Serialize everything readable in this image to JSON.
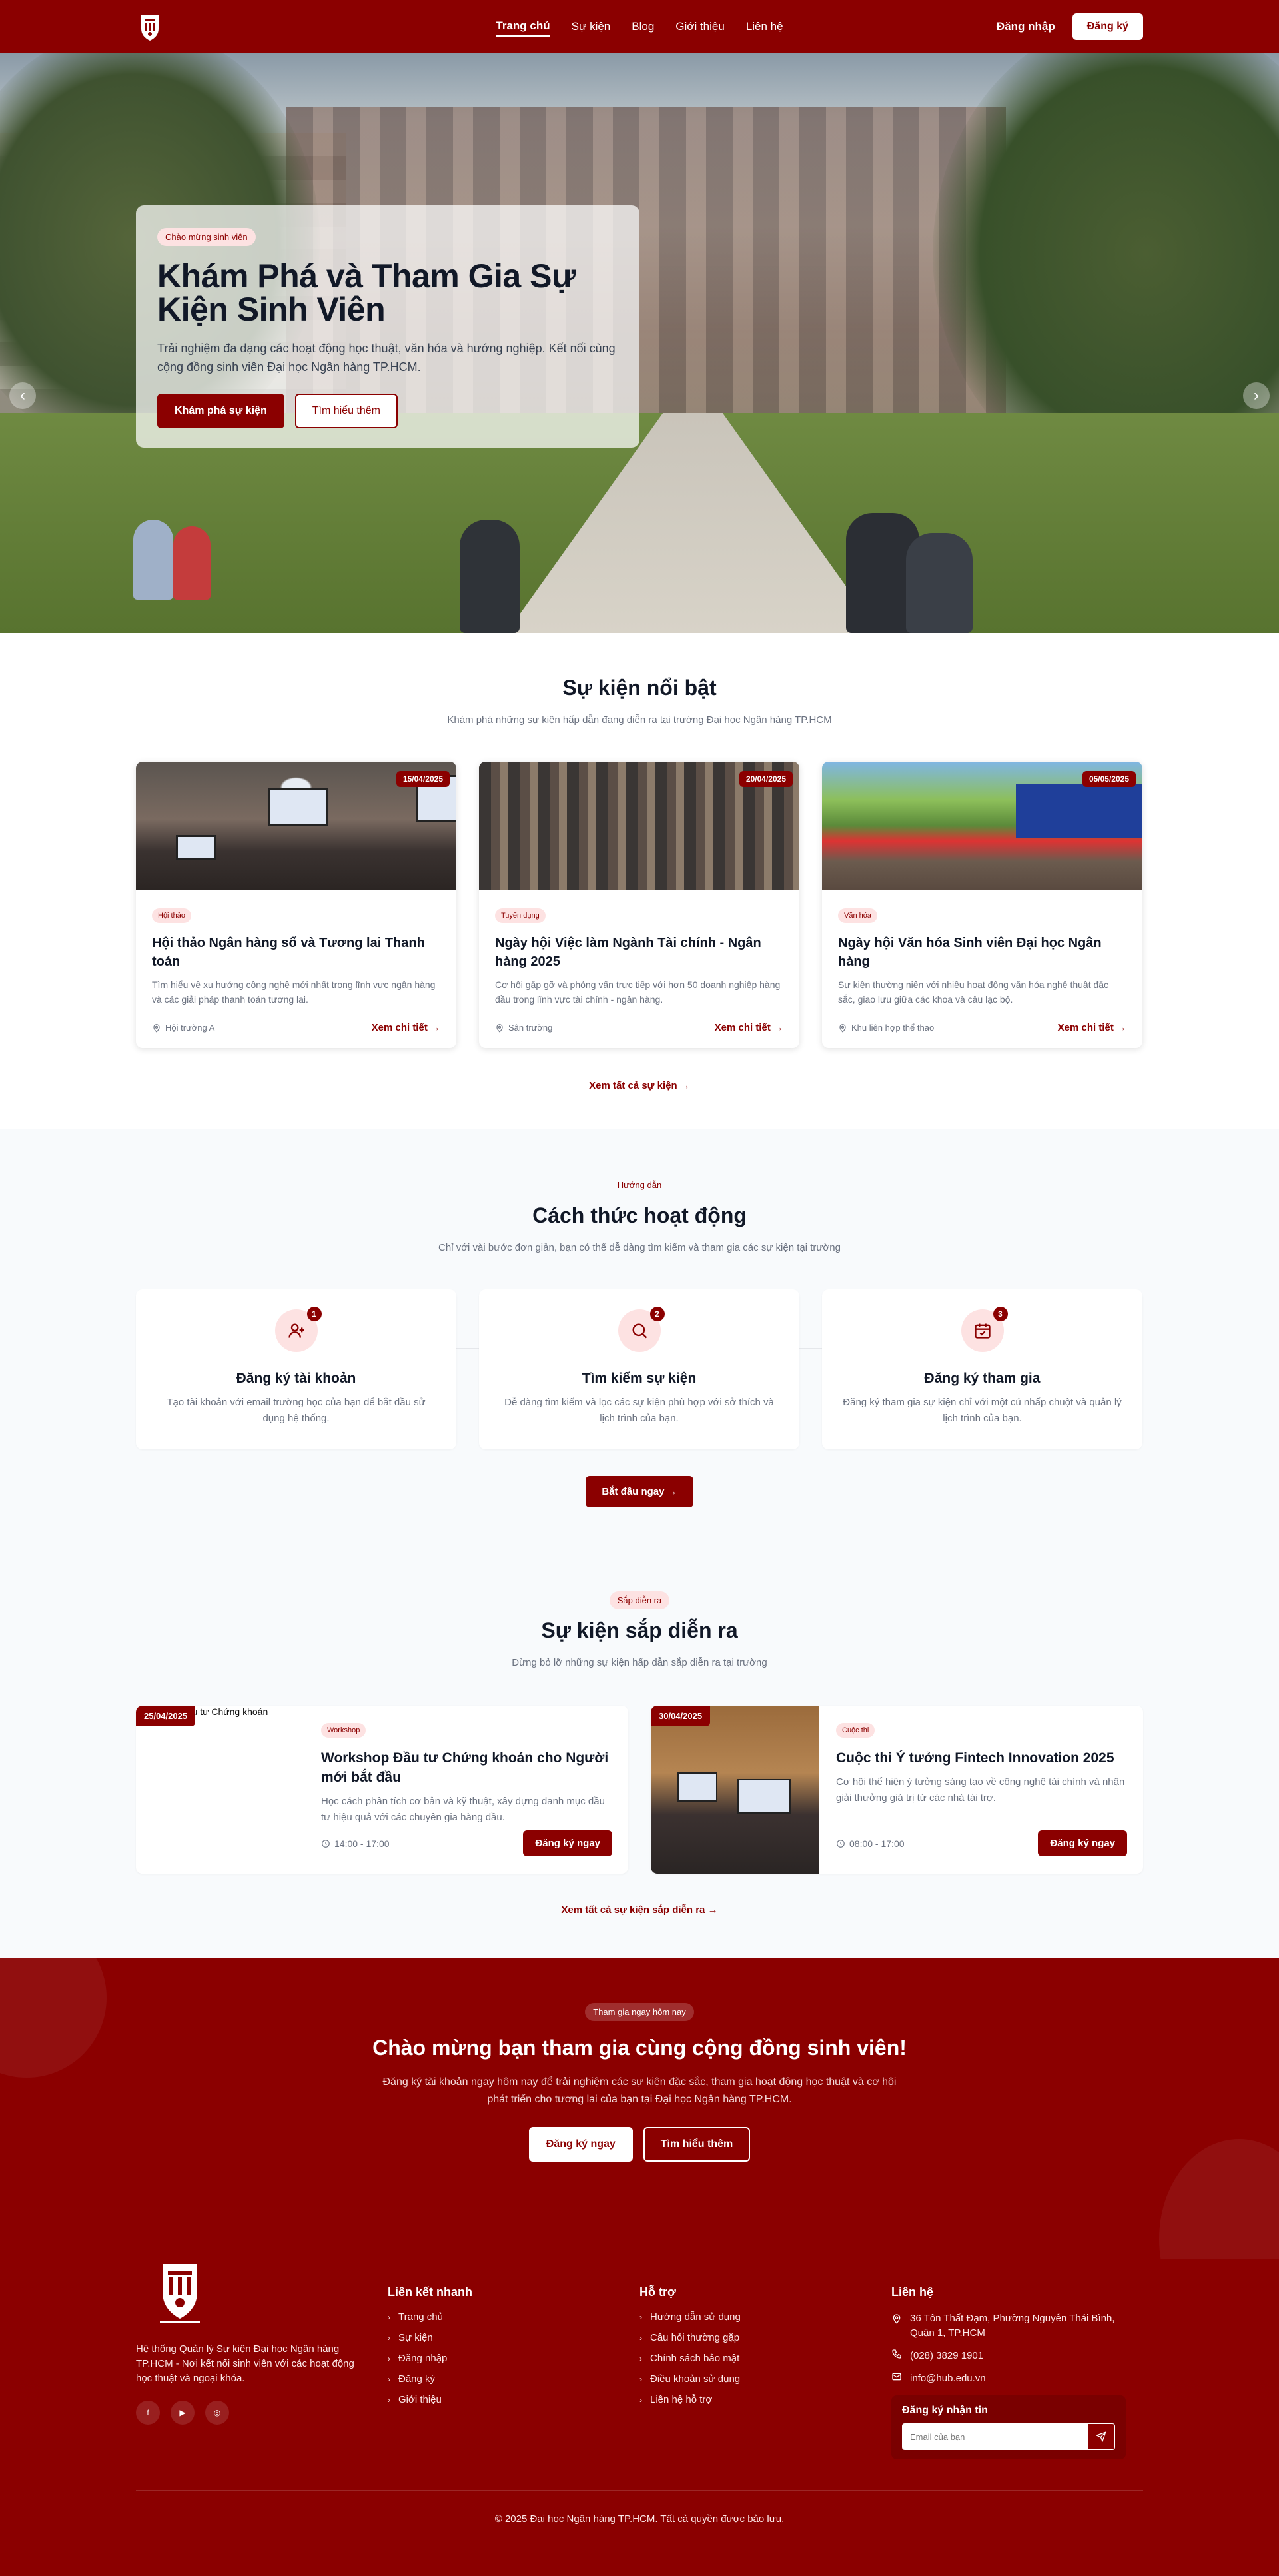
{
  "header": {
    "nav": [
      {
        "label": "Trang chủ",
        "active": true
      },
      {
        "label": "Sự kiện",
        "active": false
      },
      {
        "label": "Blog",
        "active": false
      },
      {
        "label": "Giới thiệu",
        "active": false
      },
      {
        "label": "Liên hệ",
        "active": false
      }
    ],
    "login_label": "Đăng nhập",
    "register_label": "Đăng ký"
  },
  "hero": {
    "badge": "Chào mừng sinh viên",
    "title": "Khám Phá và Tham Gia Sự Kiện Sinh Viên",
    "description": "Trải nghiệm đa dạng các hoạt động học thuật, văn hóa và hướng nghiệp. Kết nối cùng cộng đồng sinh viên Đại học Ngân hàng TP.HCM.",
    "primary_btn": "Khám phá sự kiện",
    "secondary_btn": "Tìm hiểu thêm",
    "slide_count": 3,
    "active_slide": 1
  },
  "featured": {
    "title": "Sự kiện nổi bật",
    "subtitle": "Khám phá những sự kiện hấp dẫn đang diễn ra tại trường Đại học Ngân hàng TP.HCM",
    "events": [
      {
        "date": "15/04/2025",
        "tag": "Hội thảo",
        "title": "Hội thảo Ngân hàng số và Tương lai Thanh toán",
        "description": "Tìm hiểu về xu hướng công nghệ mới nhất trong lĩnh vực ngân hàng và các giải pháp thanh toán tương lai.",
        "location": "Hội trường A",
        "more": "Xem chi tiết"
      },
      {
        "date": "20/04/2025",
        "tag": "Tuyển dụng",
        "title": "Ngày hội Việc làm Ngành Tài chính - Ngân hàng 2025",
        "description": "Cơ hội gặp gỡ và phỏng vấn trực tiếp với hơn 50 doanh nghiệp hàng đầu trong lĩnh vực tài chính - ngân hàng.",
        "location": "Sân trường",
        "more": "Xem chi tiết"
      },
      {
        "date": "05/05/2025",
        "tag": "Văn hóa",
        "title": "Ngày hội Văn hóa Sinh viên Đại học Ngân hàng",
        "description": "Sự kiện thường niên với nhiều hoạt động văn hóa nghệ thuật đặc sắc, giao lưu giữa các khoa và câu lạc bộ.",
        "location": "Khu liên hợp thể thao",
        "more": "Xem chi tiết"
      }
    ],
    "see_all": "Xem tất cả sự kiện"
  },
  "how": {
    "badge": "Hướng dẫn",
    "title": "Cách thức hoạt động",
    "subtitle": "Chỉ với vài bước đơn giản, bạn có thể dễ dàng tìm kiếm và tham gia các sự kiện tại trường",
    "steps": [
      {
        "num": "1",
        "title": "Đăng ký tài khoản",
        "description": "Tạo tài khoản với email trường học của bạn để bắt đầu sử dụng hệ thống."
      },
      {
        "num": "2",
        "title": "Tìm kiếm sự kiện",
        "description": "Dễ dàng tìm kiếm và lọc các sự kiện phù hợp với sở thích và lịch trình của bạn."
      },
      {
        "num": "3",
        "title": "Đăng ký tham gia",
        "description": "Đăng ký tham gia sự kiện chỉ với một cú nhấp chuột và quản lý lịch trình của bạn."
      }
    ],
    "cta": "Bắt đầu ngay"
  },
  "upcoming": {
    "badge": "Sắp diễn ra",
    "title": "Sự kiện sắp diễn ra",
    "subtitle": "Đừng bỏ lỡ những sự kiện hấp dẫn sắp diễn ra tại trường",
    "events": [
      {
        "date": "25/04/2025",
        "image_alt": "Workshop Đầu tư Chứng khoán",
        "tag": "Workshop",
        "title": "Workshop Đầu tư Chứng khoán cho Người mới bắt đầu",
        "description": "Học cách phân tích cơ bản và kỹ thuật, xây dựng danh mục đầu tư hiệu quả với các chuyên gia hàng đầu.",
        "time": "14:00 - 17:00",
        "register": "Đăng ký ngay"
      },
      {
        "date": "30/04/2025",
        "tag": "Cuộc thi",
        "title": "Cuộc thi Ý tưởng Fintech Innovation 2025",
        "description": "Cơ hội thể hiện ý tưởng sáng tạo về công nghệ tài chính và nhận giải thưởng giá trị từ các nhà tài trợ.",
        "time": "08:00 - 17:00",
        "register": "Đăng ký ngay"
      }
    ],
    "see_all": "Xem tất cả sự kiện sắp diễn ra"
  },
  "cta": {
    "badge": "Tham gia ngay hôm nay",
    "title": "Chào mừng bạn tham gia cùng cộng đồng sinh viên!",
    "description": "Đăng ký tài khoản ngay hôm nay để trải nghiệm các sự kiện đặc sắc, tham gia hoạt động học thuật và cơ hội phát triển cho tương lai của bạn tại Đại học Ngân hàng TP.HCM.",
    "primary_btn": "Đăng ký ngay",
    "secondary_btn": "Tìm hiểu thêm"
  },
  "footer": {
    "about": "Hệ thống Quản lý Sự kiện Đại học Ngân hàng TP.HCM - Nơi kết nối sinh viên với các hoạt động học thuật và ngoại khóa.",
    "quick_links_title": "Liên kết nhanh",
    "quick_links": [
      "Trang chủ",
      "Sự kiện",
      "Đăng nhập",
      "Đăng ký",
      "Giới thiệu"
    ],
    "support_title": "Hỗ trợ",
    "support_links": [
      "Hướng dẫn sử dụng",
      "Câu hỏi thường gặp",
      "Chính sách bảo mật",
      "Điều khoản sử dụng",
      "Liên hệ hỗ trợ"
    ],
    "contact_title": "Liên hệ",
    "address": "36 Tôn Thất Đạm, Phường Nguyễn Thái Bình, Quận 1, TP.HCM",
    "phone": "(028) 3829 1901",
    "email": "info@hub.edu.vn",
    "newsletter_title": "Đăng ký nhận tin",
    "newsletter_placeholder": "Email của bạn",
    "copyright": "© 2025 Đại học Ngân hàng TP.HCM. Tất cả quyền được bảo lưu."
  },
  "colors": {
    "brand": "#8b0000",
    "brand_light": "#fde2e2",
    "section_bg": "#f8fafc"
  }
}
